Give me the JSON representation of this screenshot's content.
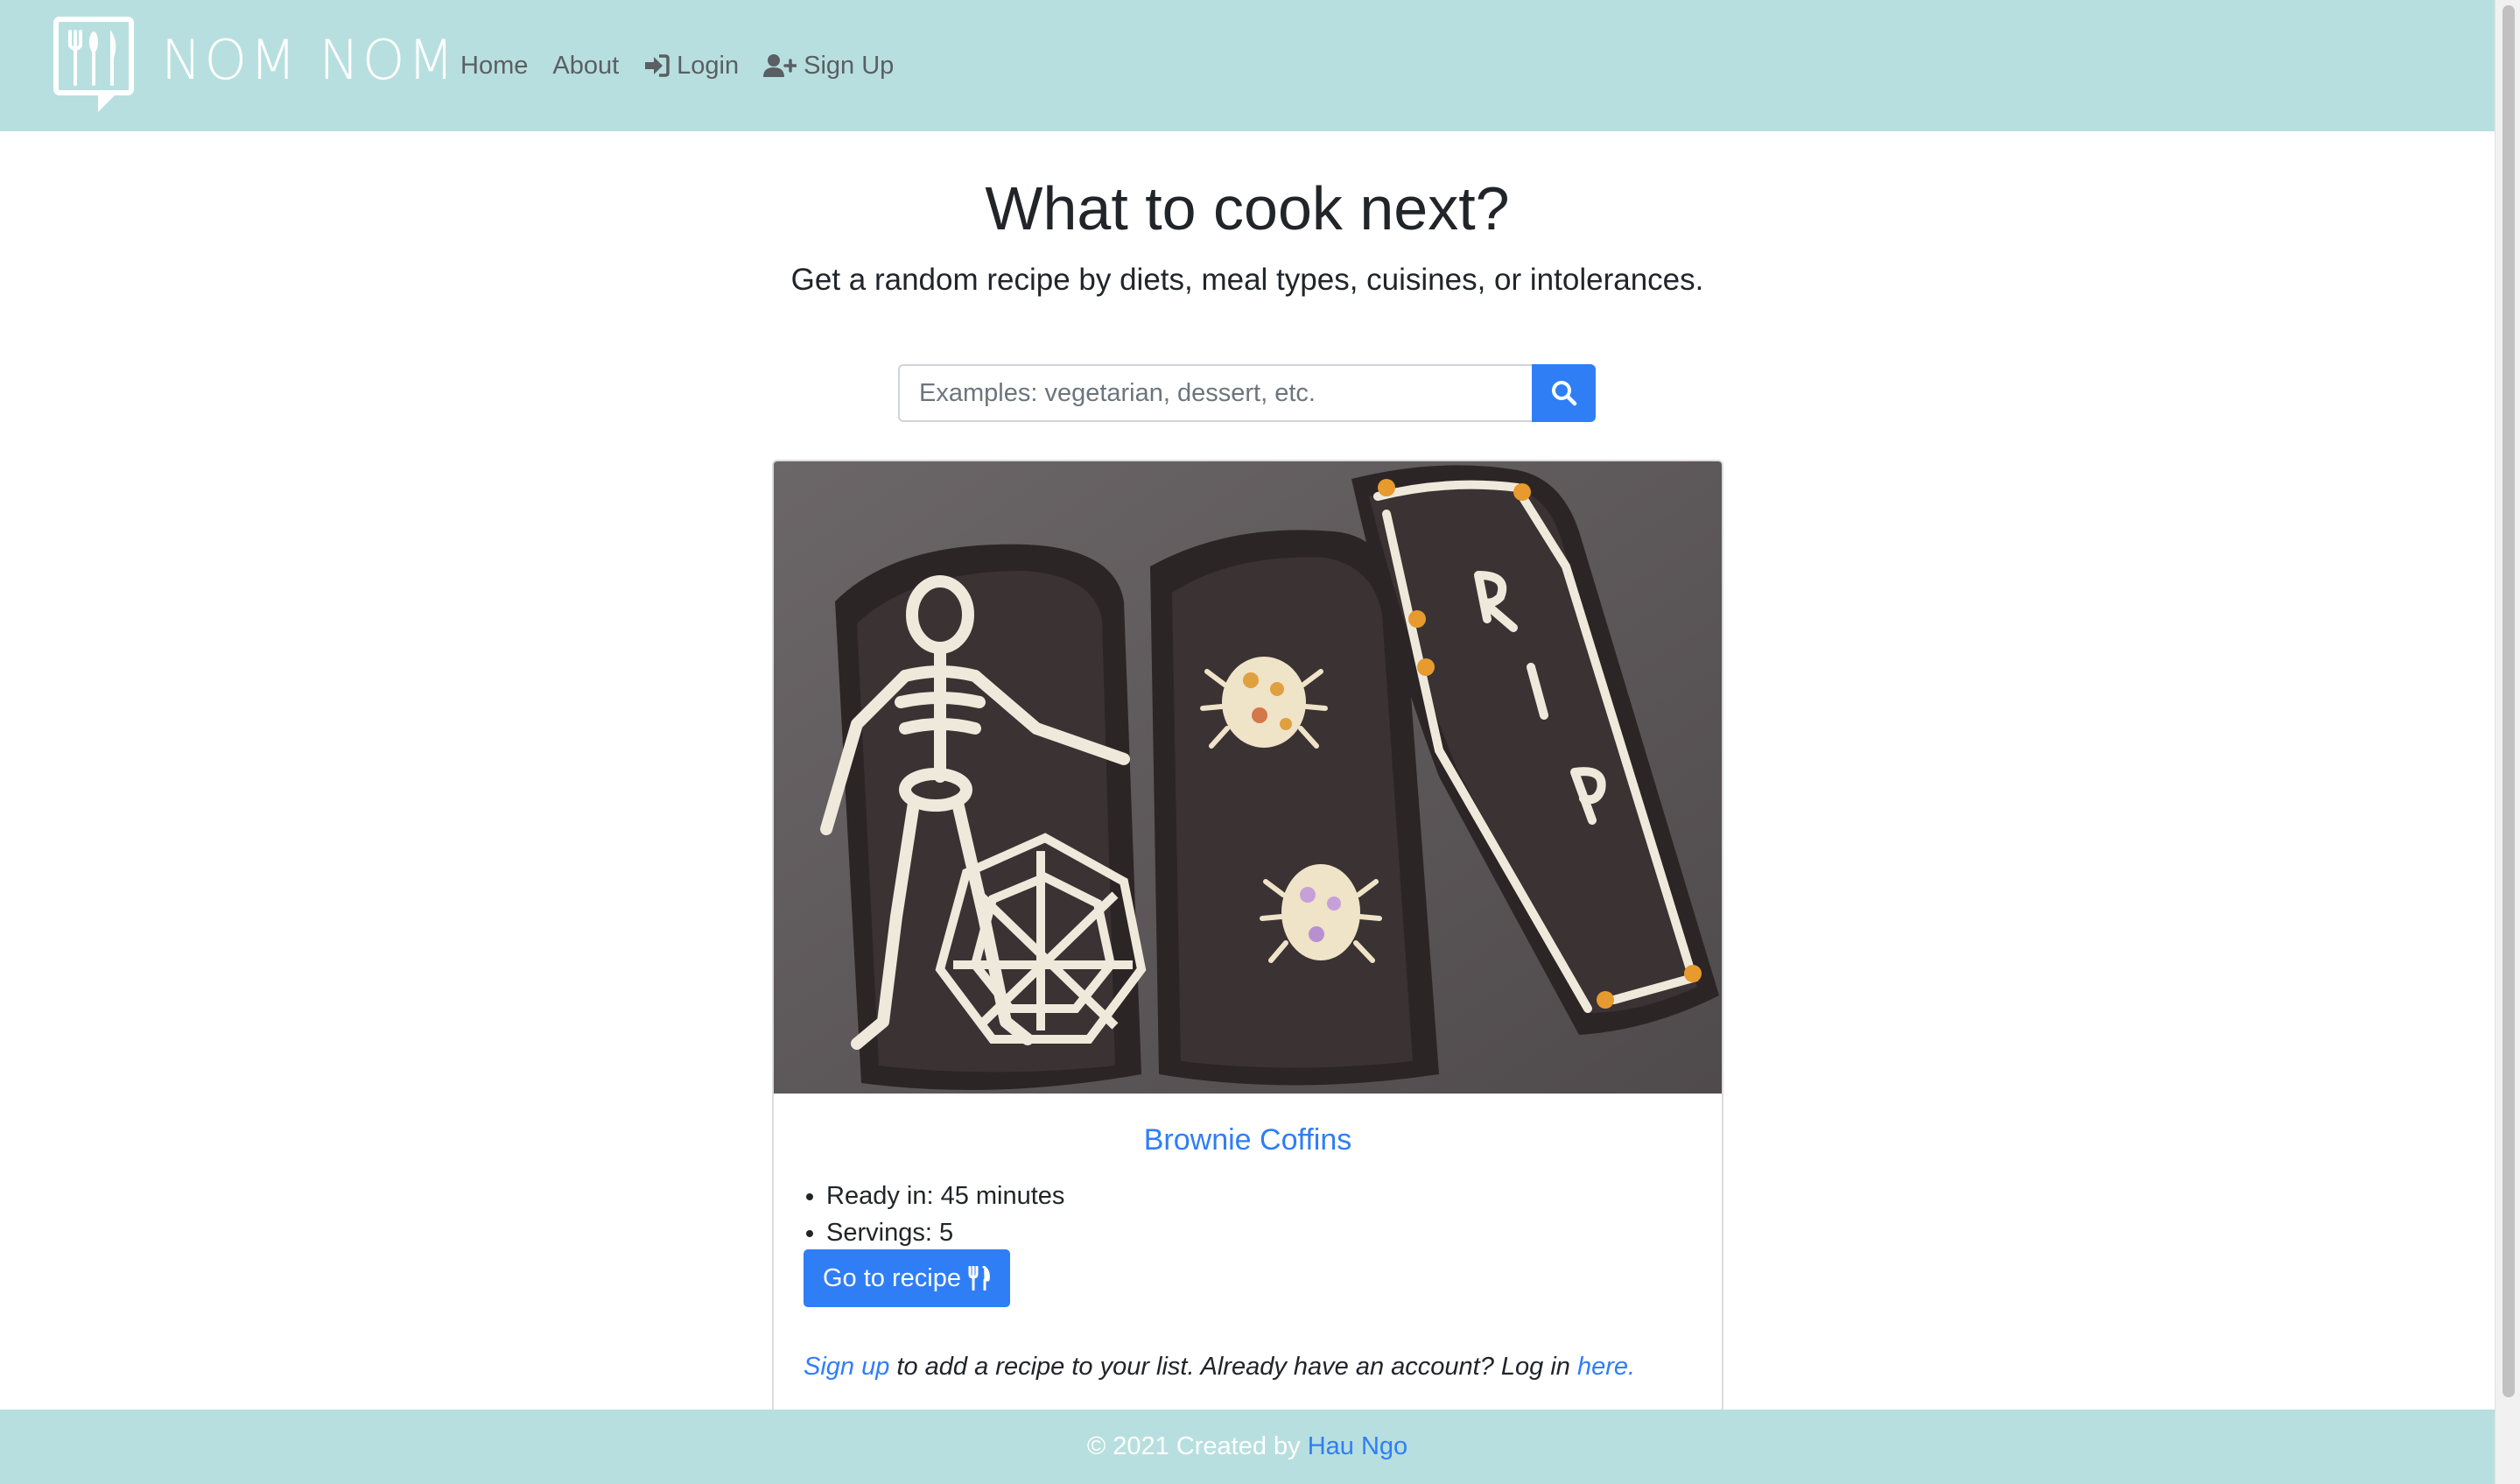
{
  "brand": {
    "name": "NOM NOM",
    "logo_icon": "fork-knife-speech-bubble-icon"
  },
  "nav": {
    "home": "Home",
    "about": "About",
    "login": "Login",
    "login_icon": "sign-in-icon",
    "signup": "Sign Up",
    "signup_icon": "user-plus-icon"
  },
  "hero": {
    "title": "What to cook next?",
    "subtitle": "Get a random recipe by diets, meal types, cuisines, or intolerances."
  },
  "search": {
    "value": "",
    "placeholder": "Examples: vegetarian, dessert, etc.",
    "button_icon": "search-icon"
  },
  "recipe": {
    "image_alt": "Brownie Coffins",
    "title": "Brownie Coffins",
    "details": [
      "Ready in: 45 minutes",
      "Servings: 5"
    ],
    "button_label": "Go to recipe",
    "button_icon": "utensils-icon"
  },
  "note": {
    "signup_link": "Sign up",
    "middle_text": " to add a recipe to your list. Already have an account? Log in ",
    "here_link": "here."
  },
  "footer": {
    "text": "© 2021 Created by",
    "author_link": "Hau Ngo"
  },
  "colors": {
    "navbar_bg": "#b8dfdf",
    "primary": "#2f7ef6",
    "text": "#212529",
    "nav_text": "#5a5f63"
  }
}
